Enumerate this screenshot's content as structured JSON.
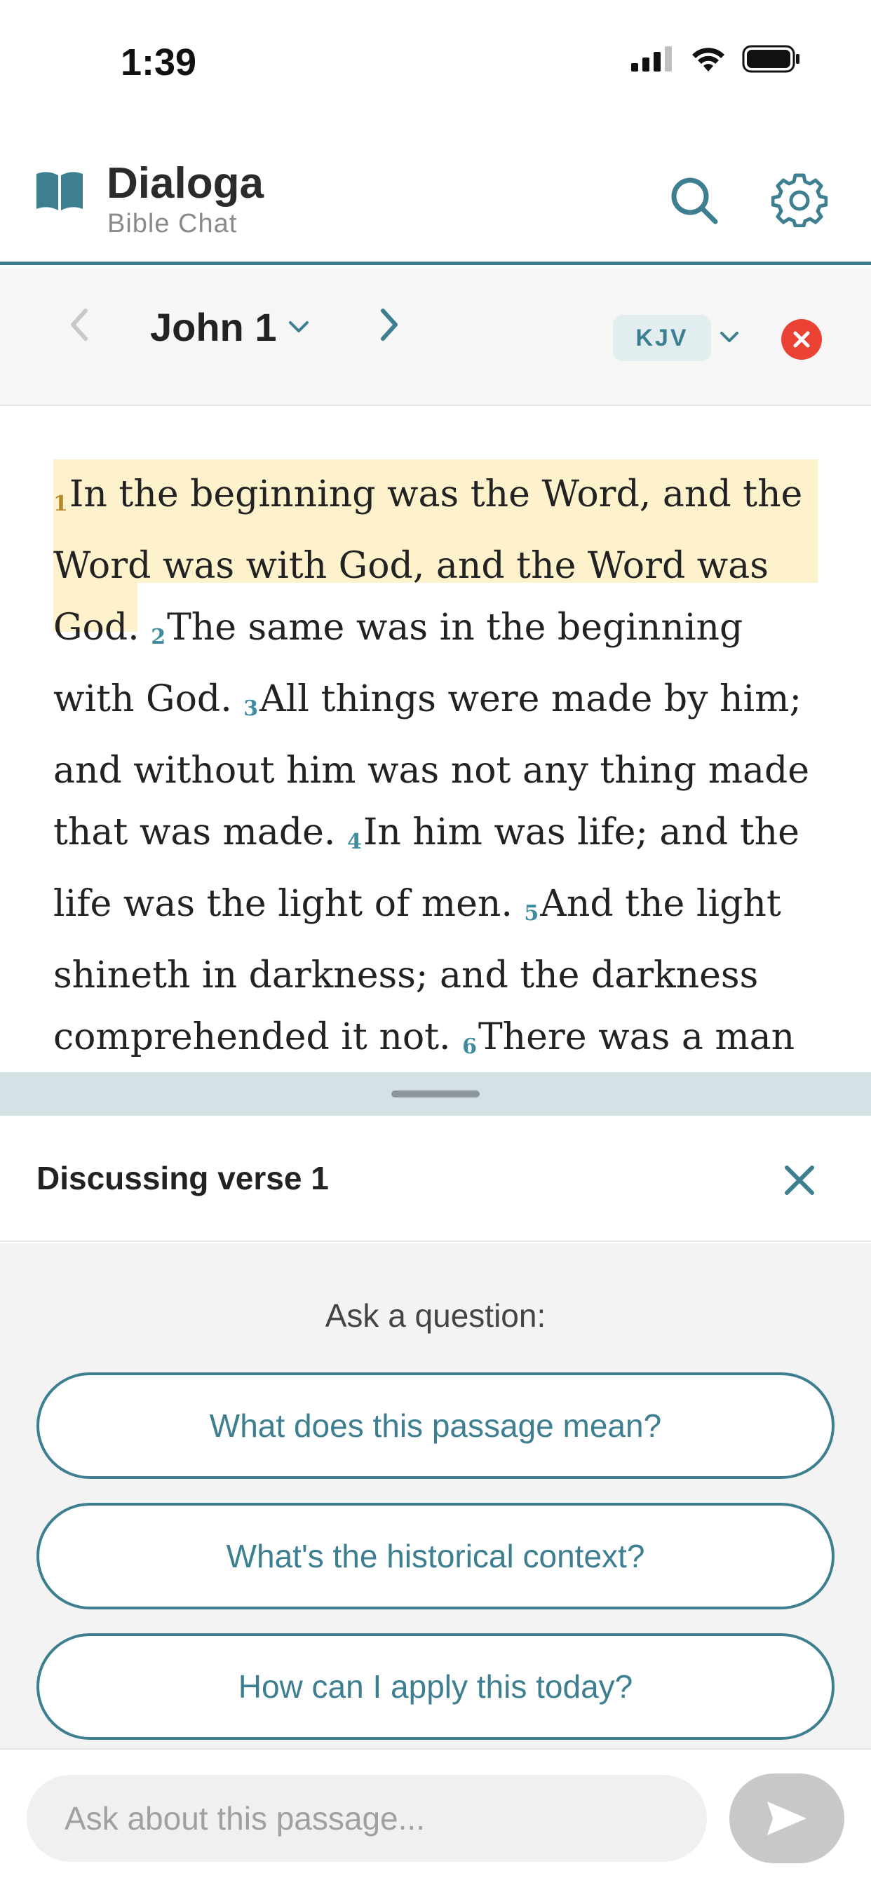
{
  "status_bar": {
    "time": "1:39",
    "icons": [
      "signal-icon",
      "wifi-icon",
      "battery-icon"
    ]
  },
  "header": {
    "app_name": "Dialoga",
    "app_subtitle": "Bible Chat",
    "logo_icon": "open-book-icon",
    "search_icon": "search-icon",
    "settings_icon": "gear-icon"
  },
  "nav": {
    "chapter": "John 1",
    "version": "KJV",
    "prev_icon": "chevron-left-icon",
    "next_icon": "chevron-right-icon",
    "close_icon": "close-circle-icon"
  },
  "scripture": {
    "verses": [
      {
        "num": "1",
        "text": "In the beginning was the Word, and the Word was with God, and the Word was God."
      },
      {
        "num": "2",
        "text": "The same was in the beginning with God."
      },
      {
        "num": "3",
        "text": "All things were made by him; and without him was not any thing made that was made."
      },
      {
        "num": "4",
        "text": "In him was life; and the life was the light of men."
      },
      {
        "num": "5",
        "text": "And the light shineth in darkness; and the darkness comprehended it not."
      },
      {
        "num": "6",
        "text": "There was a man sent from God, whose name was John."
      }
    ]
  },
  "discussion": {
    "title": "Discussing verse 1",
    "ask_label": "Ask a question:",
    "suggestions": [
      "What does this passage mean?",
      "What's the historical context?",
      "How can I apply this today?"
    ]
  },
  "input": {
    "placeholder": "Ask about this passage..."
  },
  "colors": {
    "accent": "#3d7f91",
    "highlight": "#fdf2cc",
    "close_red": "#ea4335"
  }
}
